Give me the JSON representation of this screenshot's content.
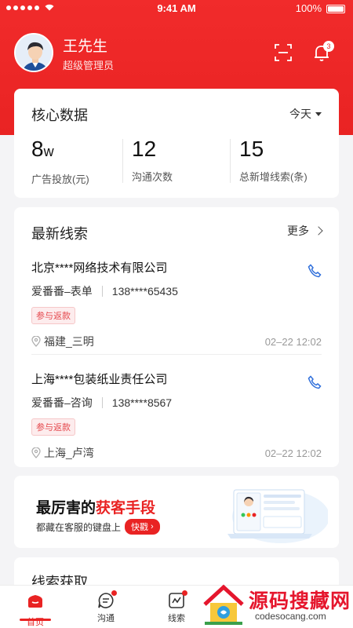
{
  "status": {
    "time": "9:41 AM",
    "battery": "100%"
  },
  "user": {
    "name": "王先生",
    "role": "超级管理员",
    "notification_count": "3"
  },
  "core": {
    "title": "核心数据",
    "period": "今天",
    "stats": [
      {
        "value": "8",
        "unit": "w",
        "label": "广告投放(元)"
      },
      {
        "value": "12",
        "unit": "",
        "label": "沟通次数"
      },
      {
        "value": "15",
        "unit": "",
        "label": "总新增线索(条)"
      }
    ]
  },
  "leads": {
    "title": "最新线索",
    "more": "更多",
    "items": [
      {
        "company": "北京****网络技术有限公司",
        "source": "爱番番–表单",
        "phone": "138****65435",
        "tag": "参与返款",
        "location": "福建_三明",
        "date": "02–22 12:02"
      },
      {
        "company": "上海****包装纸业责任公司",
        "source": "爱番番–咨询",
        "phone": "138****8567",
        "tag": "参与返款",
        "location": "上海_卢湾",
        "date": "02–22 12:02"
      }
    ]
  },
  "banner": {
    "title_prefix": "最厉害的",
    "title_highlight": "获客手段",
    "subtitle": "都藏在客服的键盘上",
    "button": "快戳"
  },
  "next_section": {
    "title": "线索获取"
  },
  "tabs": [
    {
      "label": "首页",
      "icon": "home-icon",
      "active": true
    },
    {
      "label": "沟通",
      "icon": "chat-icon"
    },
    {
      "label": "线索",
      "icon": "leads-icon"
    }
  ],
  "watermark": {
    "text": "源码搜藏网",
    "url": "codesocang.com"
  },
  "colors": {
    "brand": "#e92323",
    "tag": "#e5484d",
    "phone": "#2f6fdb"
  }
}
